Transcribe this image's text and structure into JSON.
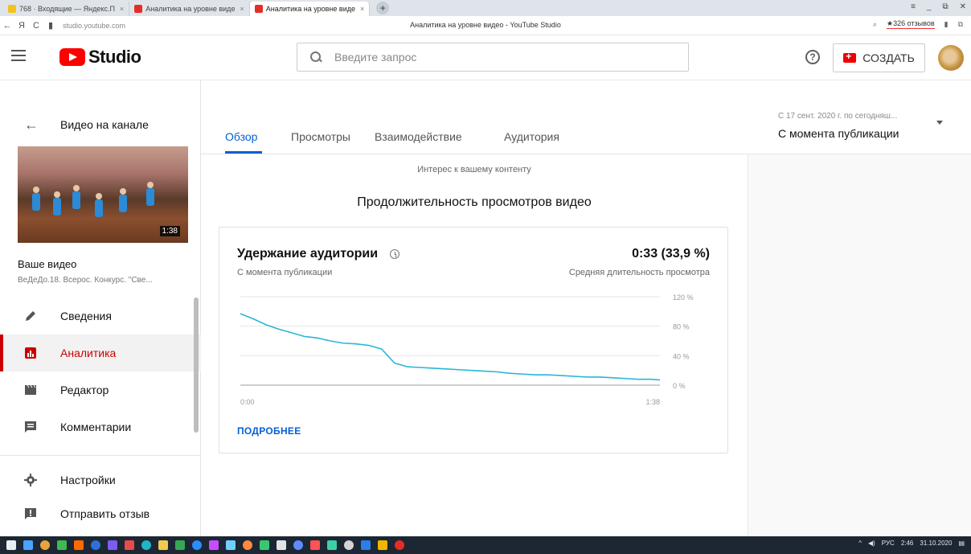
{
  "browser": {
    "tabs": [
      {
        "label": "768 · Входящие — Яндекс.П",
        "color": "#f0c419"
      },
      {
        "label": "Аналитика на уровне виде",
        "color": "#e52d27"
      },
      {
        "label": "Аналитика на уровне виде",
        "color": "#e52d27",
        "active": true
      }
    ],
    "new_tab": "+",
    "url": "studio.youtube.com",
    "page_title": "Аналитика на уровне видео - YouTube Studio",
    "reviews": "★326 отзывов",
    "nav": {
      "back": "←",
      "yandex": "Я",
      "reload": "C"
    }
  },
  "header": {
    "logo_text": "Studio",
    "search_placeholder": "Введите запрос",
    "help": "?",
    "create_label": "СОЗДАТЬ"
  },
  "sidebar": {
    "back_label": "Видео на канале",
    "duration": "1:38",
    "your_video": "Ваше видео",
    "video_desc": "ВеДеДо.18. Всерос. Конкурс. \"Све...",
    "items": [
      {
        "label": "Сведения",
        "icon": "pencil-icon",
        "active": false
      },
      {
        "label": "Аналитика",
        "icon": "analytics-icon",
        "active": true
      },
      {
        "label": "Редактор",
        "icon": "clapperboard-icon",
        "active": false
      },
      {
        "label": "Комментарии",
        "icon": "comment-icon",
        "active": false
      },
      {
        "label": "Настройки",
        "icon": "gear-icon",
        "active": false
      },
      {
        "label": "Отправить отзыв",
        "icon": "feedback-icon",
        "active": false
      }
    ]
  },
  "tabs": [
    {
      "label": "Обзор",
      "active": true
    },
    {
      "label": "Просмотры",
      "active": false
    },
    {
      "label": "Взаимодействие",
      "active": false
    },
    {
      "label": "Аудитория",
      "active": false
    }
  ],
  "period": {
    "range": "С 17 сент. 2020 г. по сегодняш...",
    "selected": "С момента публикации"
  },
  "main": {
    "interest": "Интерес к вашему контенту",
    "section_title": "Продолжительность просмотров видео"
  },
  "card": {
    "title": "Удержание аудитории",
    "subtitle": "С момента публикации",
    "value": "0:33 (33,9 %)",
    "value_label": "Средняя длительность просмотра",
    "more": "ПОДРОБНЕЕ"
  },
  "chart_data": {
    "type": "line",
    "title": "Удержание аудитории",
    "xlabel": "",
    "ylabel": "",
    "x_ticks": [
      "0:00",
      "1:38"
    ],
    "y_ticks": [
      "120 %",
      "80 %",
      "40 %",
      "0 %"
    ],
    "ylim": [
      0,
      120
    ],
    "xlim": [
      0,
      98
    ],
    "grid": true,
    "series": [
      {
        "color": "#2bb5d8",
        "x": [
          0,
          3,
          6,
          9,
          12,
          15,
          18,
          21,
          24,
          27,
          30,
          33,
          36,
          39,
          42,
          45,
          48,
          51,
          54,
          57,
          60,
          63,
          66,
          69,
          72,
          75,
          78,
          81,
          84,
          87,
          90,
          93,
          96,
          98
        ],
        "y": [
          97,
          90,
          82,
          76,
          71,
          66,
          64,
          60,
          57,
          56,
          54,
          49,
          30,
          25,
          24,
          23,
          22,
          21,
          20,
          19,
          18,
          16,
          15,
          14,
          14,
          13,
          12,
          11,
          11,
          10,
          9,
          8,
          8,
          7
        ]
      }
    ]
  },
  "taskbar": {
    "lang": "РУС",
    "time": "2:46",
    "date": "31.10.2020",
    "icons": [
      "#4aa3ff",
      "#e9a33a",
      "#3fb950",
      "#ff6a00",
      "#2f6fd6",
      "#7d5cf2",
      "#e94b4b",
      "#1fb7c4",
      "#f2c94c",
      "#36a852",
      "#2d8cff",
      "#c84bff",
      "#6ed0ff",
      "#ff8a3d",
      "#37c871",
      "#e3e3e3",
      "#5e8cff",
      "#ff5252",
      "#3bd1a6",
      "#d4d4d4",
      "#2b7de9",
      "#f4b400",
      "#e52d27"
    ]
  }
}
